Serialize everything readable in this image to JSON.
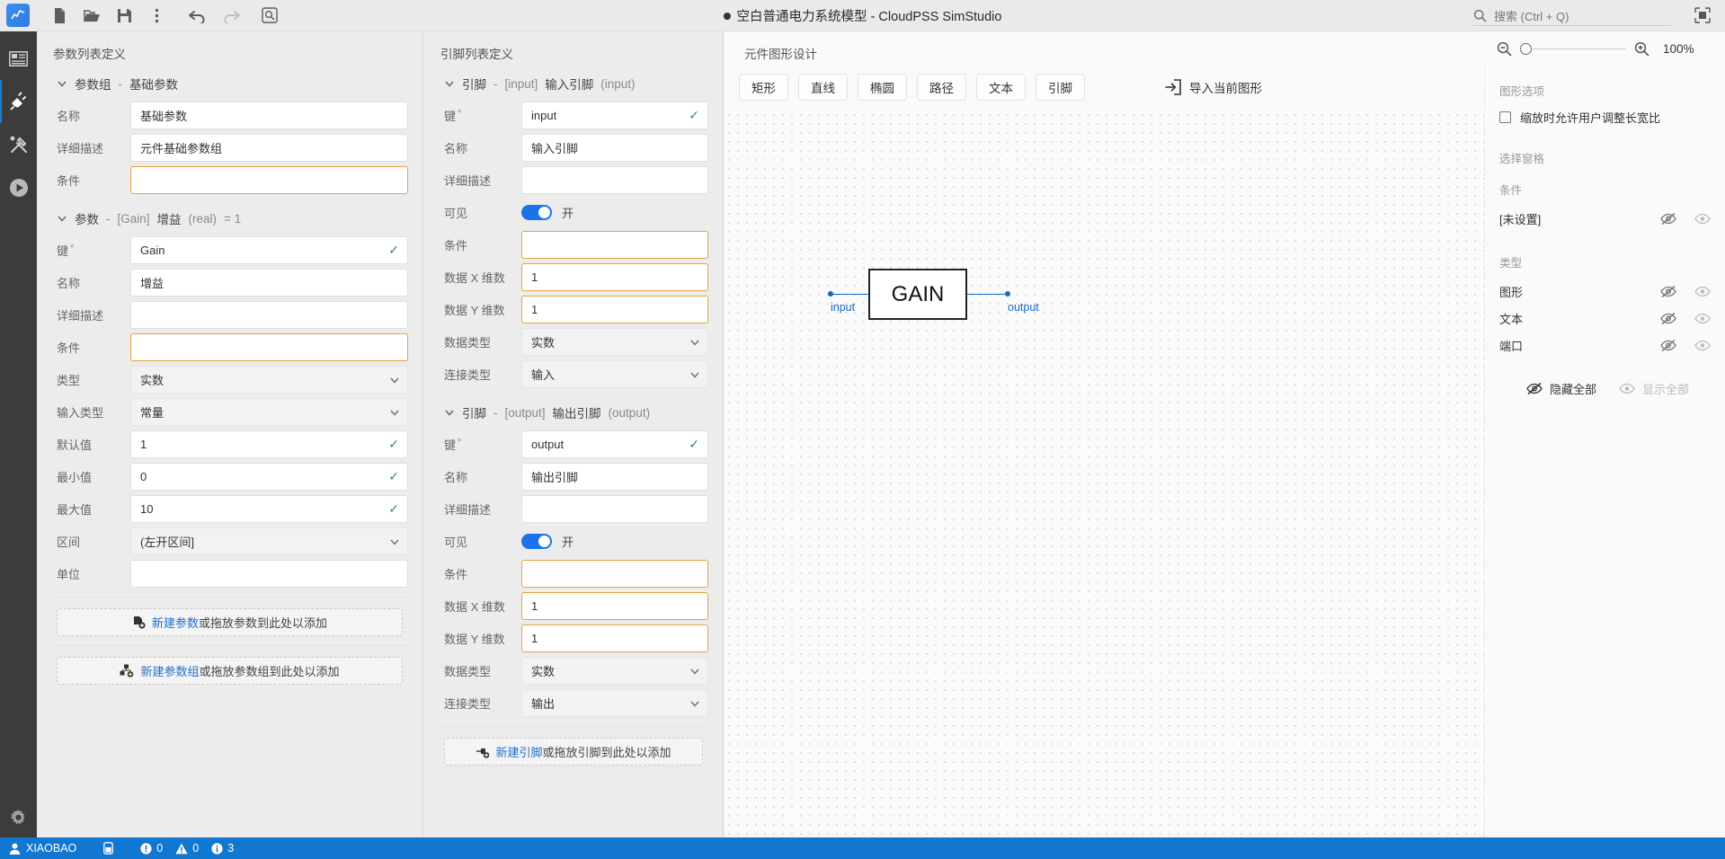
{
  "titlebar": {
    "app_icon": "cloudpss-logo-icon",
    "tools": [
      {
        "name": "new-file-button",
        "icon": "file-icon"
      },
      {
        "name": "open-folder-button",
        "icon": "folder-open-icon"
      },
      {
        "name": "save-button",
        "icon": "save-disk-icon"
      },
      {
        "name": "more-button",
        "icon": "vertical-dots-icon"
      },
      {
        "name": "undo-button",
        "icon": "undo-arrow-icon"
      },
      {
        "name": "redo-button",
        "icon": "redo-arrow-icon"
      },
      {
        "name": "inspect-button",
        "icon": "search-box-icon"
      }
    ],
    "title": "空白普通电力系统模型 - CloudPSS SimStudio",
    "modified_dot": true,
    "search_placeholder": "搜索 (Ctrl + Q)",
    "window_control": "maximize-restore-icon"
  },
  "activitybar": {
    "items": [
      {
        "name": "sidebar-item-layout",
        "icon": "layout-panel-icon",
        "active": false
      },
      {
        "name": "sidebar-item-component",
        "icon": "plug-icon",
        "active": true
      },
      {
        "name": "sidebar-item-tools",
        "icon": "hammer-wrench-icon",
        "active": false
      },
      {
        "name": "sidebar-item-run",
        "icon": "play-circle-icon",
        "active": false
      }
    ],
    "settings": {
      "name": "sidebar-item-settings",
      "icon": "gear-icon"
    }
  },
  "params_panel": {
    "title": "参数列表定义",
    "group": {
      "header_prefix": "参数组",
      "header_sep": "-",
      "header_name": "基础参数",
      "fields": [
        {
          "label": "名称",
          "value": "基础参数",
          "kind": "text",
          "state": "normal",
          "required": false
        },
        {
          "label": "详细描述",
          "value": "元件基础参数组",
          "kind": "text",
          "state": "normal",
          "required": false
        },
        {
          "label": "条件",
          "value": "",
          "kind": "text",
          "state": "warn",
          "required": false
        }
      ]
    },
    "parameter": {
      "header_prefix": "参数",
      "header_sep": "-",
      "header_key": "[Gain]",
      "header_name": "增益",
      "header_type": "(real)",
      "header_eq": "= 1",
      "fields": [
        {
          "label": "键",
          "value": "Gain",
          "kind": "text",
          "state": "normal",
          "required": true,
          "valid": true
        },
        {
          "label": "名称",
          "value": "增益",
          "kind": "text",
          "state": "normal",
          "required": false
        },
        {
          "label": "详细描述",
          "value": "",
          "kind": "text",
          "state": "normal",
          "required": false
        },
        {
          "label": "条件",
          "value": "",
          "kind": "text",
          "state": "warn",
          "required": false
        },
        {
          "label": "类型",
          "value": "实数",
          "kind": "select",
          "state": "select",
          "required": false
        },
        {
          "label": "输入类型",
          "value": "常量",
          "kind": "select",
          "state": "select",
          "required": false
        },
        {
          "label": "默认值",
          "value": "1",
          "kind": "text",
          "state": "normal",
          "required": false,
          "valid": true
        },
        {
          "label": "最小值",
          "value": "0",
          "kind": "text",
          "state": "normal",
          "required": false,
          "valid": true
        },
        {
          "label": "最大值",
          "value": "10",
          "kind": "text",
          "state": "normal",
          "required": false,
          "valid": true
        },
        {
          "label": "区间",
          "value": "(左开区间]",
          "kind": "select",
          "state": "select",
          "required": false
        },
        {
          "label": "单位",
          "value": "",
          "kind": "text",
          "state": "normal",
          "required": false
        }
      ]
    },
    "add_param": {
      "icon": "add-parameter-icon",
      "link": "新建参数",
      "rest": "或拖放参数到此处以添加"
    },
    "add_group": {
      "icon": "add-parameter-group-icon",
      "link": "新建参数组",
      "rest": "或拖放参数组到此处以添加"
    }
  },
  "pins_panel": {
    "title": "引脚列表定义",
    "pins": [
      {
        "header_prefix": "引脚",
        "header_sep": "-",
        "header_key": "[input]",
        "header_name": "输入引脚",
        "header_suffix": "(input)",
        "fields": [
          {
            "label": "键",
            "value": "input",
            "kind": "text",
            "state": "normal",
            "required": true,
            "valid": true
          },
          {
            "label": "名称",
            "value": "输入引脚",
            "kind": "text",
            "state": "normal",
            "required": false
          },
          {
            "label": "详细描述",
            "value": "",
            "kind": "text",
            "state": "normal",
            "required": false
          },
          {
            "label": "可见",
            "value": "开",
            "kind": "toggle",
            "state": "on",
            "required": false
          },
          {
            "label": "条件",
            "value": "",
            "kind": "text",
            "state": "warn",
            "required": false
          },
          {
            "label": "数据 X 维数",
            "value": "1",
            "kind": "text",
            "state": "warn",
            "required": false
          },
          {
            "label": "数据 Y 维数",
            "value": "1",
            "kind": "text",
            "state": "warn",
            "required": false
          },
          {
            "label": "数据类型",
            "value": "实数",
            "kind": "select",
            "state": "select",
            "required": false
          },
          {
            "label": "连接类型",
            "value": "输入",
            "kind": "select",
            "state": "select",
            "required": false
          }
        ]
      },
      {
        "header_prefix": "引脚",
        "header_sep": "-",
        "header_key": "[output]",
        "header_name": "输出引脚",
        "header_suffix": "(output)",
        "fields": [
          {
            "label": "键",
            "value": "output",
            "kind": "text",
            "state": "normal",
            "required": true,
            "valid": true
          },
          {
            "label": "名称",
            "value": "输出引脚",
            "kind": "text",
            "state": "normal",
            "required": false
          },
          {
            "label": "详细描述",
            "value": "",
            "kind": "text",
            "state": "normal",
            "required": false
          },
          {
            "label": "可见",
            "value": "开",
            "kind": "toggle",
            "state": "on",
            "required": false
          },
          {
            "label": "条件",
            "value": "",
            "kind": "text",
            "state": "warn",
            "required": false
          },
          {
            "label": "数据 X 维数",
            "value": "1",
            "kind": "text",
            "state": "warn",
            "required": false
          },
          {
            "label": "数据 Y 维数",
            "value": "1",
            "kind": "text",
            "state": "warn",
            "required": false
          },
          {
            "label": "数据类型",
            "value": "实数",
            "kind": "select",
            "state": "select",
            "required": false
          },
          {
            "label": "连接类型",
            "value": "输出",
            "kind": "select",
            "state": "select",
            "required": false
          }
        ]
      }
    ],
    "add_pin": {
      "icon": "add-pin-icon",
      "link": "新建引脚",
      "rest": "或拖放引脚到此处以添加"
    }
  },
  "shape_panel": {
    "title": "元件图形设计",
    "tools": [
      "矩形",
      "直线",
      "椭圆",
      "路径",
      "文本",
      "引脚"
    ],
    "import": {
      "label": "导入当前图形",
      "icon": "import-icon"
    },
    "canvas": {
      "block_label": "GAIN",
      "input_pin_label": "input",
      "output_pin_label": "output",
      "wire_color": "#1668c4"
    }
  },
  "zoombar": {
    "zoom_out_icon": "zoom-out-icon",
    "zoom_in_icon": "zoom-in-icon",
    "percent": "100%"
  },
  "options_panel": {
    "title": "图形选项",
    "checkbox_label": "缩放时允许用户调整长宽比",
    "checkbox_checked": false,
    "pane_title": "选择窗格",
    "condition_title": "条件",
    "condition_rows": [
      {
        "name": "[未设置]",
        "hide_icon": "eye-off-icon",
        "show_icon": "eye-icon"
      }
    ],
    "type_title": "类型",
    "type_rows": [
      {
        "name": "图形",
        "hide_icon": "eye-off-icon",
        "show_icon": "eye-icon"
      },
      {
        "name": "文本",
        "hide_icon": "eye-off-icon",
        "show_icon": "eye-icon"
      },
      {
        "name": "端口",
        "hide_icon": "eye-off-icon",
        "show_icon": "eye-icon"
      }
    ],
    "hide_all": "隐藏全部",
    "show_all": "显示全部"
  },
  "statusbar": {
    "user_icon": "person-icon",
    "user": "XIAOBAO",
    "db_icon": "database-icon",
    "error_icon": "error-circle-icon",
    "errors": "0",
    "warning_icon": "warning-triangle-icon",
    "warnings": "0",
    "info_icon": "info-circle-icon",
    "infos": "3"
  },
  "colors": {
    "accent": "#1177d1",
    "toggle_on": "#1a73e8",
    "warn_border": "#e8a33d",
    "valid_check": "#2e8b57",
    "link": "#1f6fd0",
    "wire": "#1668c4"
  }
}
